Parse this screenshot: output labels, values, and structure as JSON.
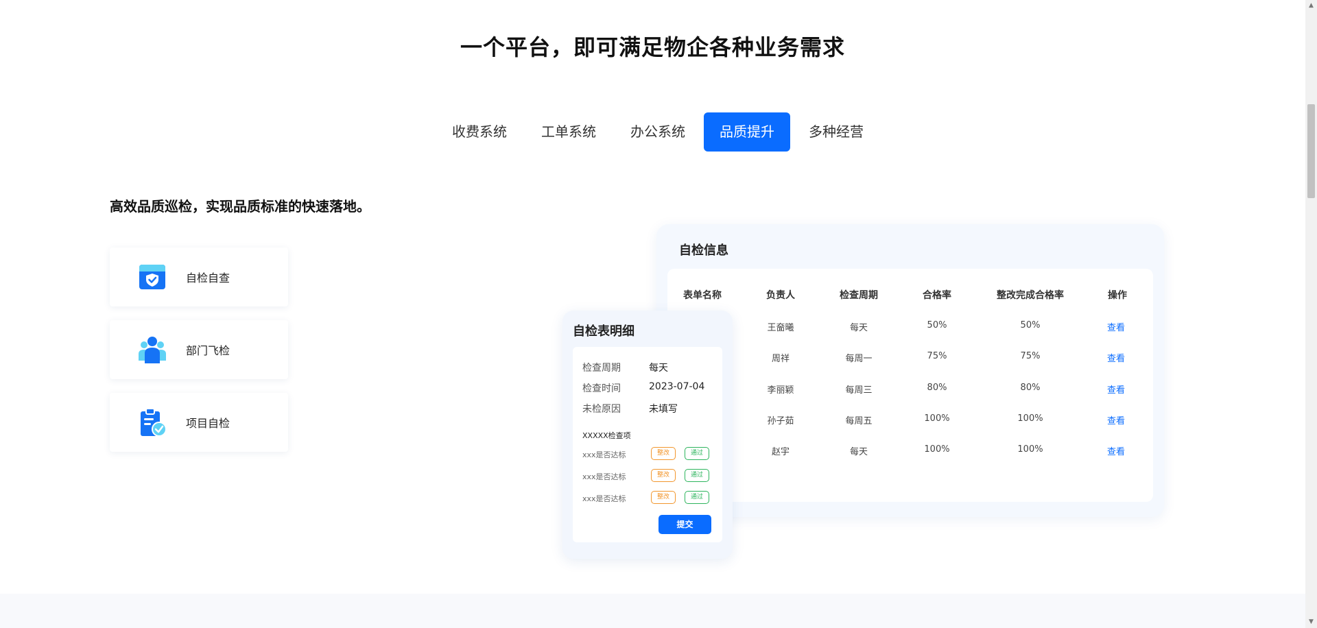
{
  "page_title": "一个平台，即可满足物企各种业务需求",
  "tabs": [
    {
      "label": "收费系统",
      "active": false
    },
    {
      "label": "工单系统",
      "active": false
    },
    {
      "label": "办公系统",
      "active": false
    },
    {
      "label": "品质提升",
      "active": true
    },
    {
      "label": "多种经营",
      "active": false
    }
  ],
  "subtitle": "高效品质巡检，实现品质标准的快速落地。",
  "features": [
    {
      "label": "自检自查",
      "icon": "calendar-shield-icon"
    },
    {
      "label": "部门飞检",
      "icon": "team-icon"
    },
    {
      "label": "项目自检",
      "icon": "clipboard-check-icon"
    }
  ],
  "info_panel": {
    "title": "自检信息",
    "headers": [
      "表单名称",
      "负责人",
      "检查周期",
      "合格率",
      "整改完成合格率",
      "操作"
    ],
    "rows": [
      [
        "王奤曦",
        "每天",
        "50%",
        "50%",
        "查看"
      ],
      [
        "周祥",
        "每周一",
        "75%",
        "75%",
        "查看"
      ],
      [
        "李丽颖",
        "每周三",
        "80%",
        "80%",
        "查看"
      ],
      [
        "孙子茹",
        "每周五",
        "100%",
        "100%",
        "查看"
      ],
      [
        "赵宇",
        "每天",
        "100%",
        "100%",
        "查看"
      ]
    ]
  },
  "detail_card": {
    "title": "自检表明细",
    "fields": [
      {
        "label": "检查周期",
        "value": "每天"
      },
      {
        "label": "检查时间",
        "value": "2023-07-04"
      },
      {
        "label": "未检原因",
        "value": "未填写"
      }
    ],
    "section_label": "XXXXX检查项",
    "items": [
      {
        "label": "xxx是否达标",
        "fix": "整改",
        "pass": "通过"
      },
      {
        "label": "xxx是否达标",
        "fix": "整改",
        "pass": "通过"
      },
      {
        "label": "xxx是否达标",
        "fix": "整改",
        "pass": "通过"
      }
    ],
    "submit": "提交"
  },
  "colors": {
    "accent": "#0a6cff",
    "orange": "#f2962c",
    "green": "#2cb45c"
  }
}
